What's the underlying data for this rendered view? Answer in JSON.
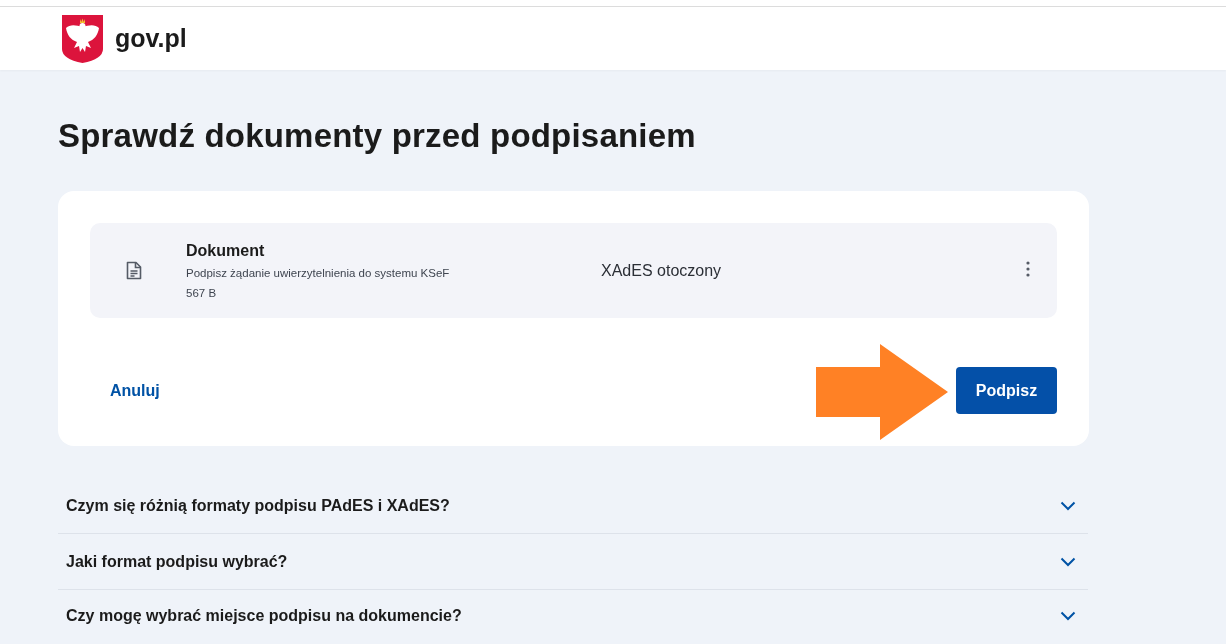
{
  "header": {
    "logo_text": "gov.pl"
  },
  "page": {
    "title": "Sprawdź dokumenty przed podpisaniem"
  },
  "documents": [
    {
      "title": "Dokument",
      "description": "Podpisz żądanie uwierzytelnienia do systemu KSeF",
      "size": "567 B",
      "format": "XAdES otoczony"
    }
  ],
  "actions": [
    {
      "label": "Anuluj",
      "kind": "link"
    },
    {
      "label": "Podpisz",
      "kind": "primary"
    }
  ],
  "faq": [
    {
      "question": "Czym się różnią formaty podpisu PAdES i XAdES?",
      "expanded": false
    },
    {
      "question": "Jaki format podpisu wybrać?",
      "expanded": false
    },
    {
      "question": "Czy mogę wybrać miejsce podpisu na dokumencie?",
      "expanded": false
    }
  ]
}
